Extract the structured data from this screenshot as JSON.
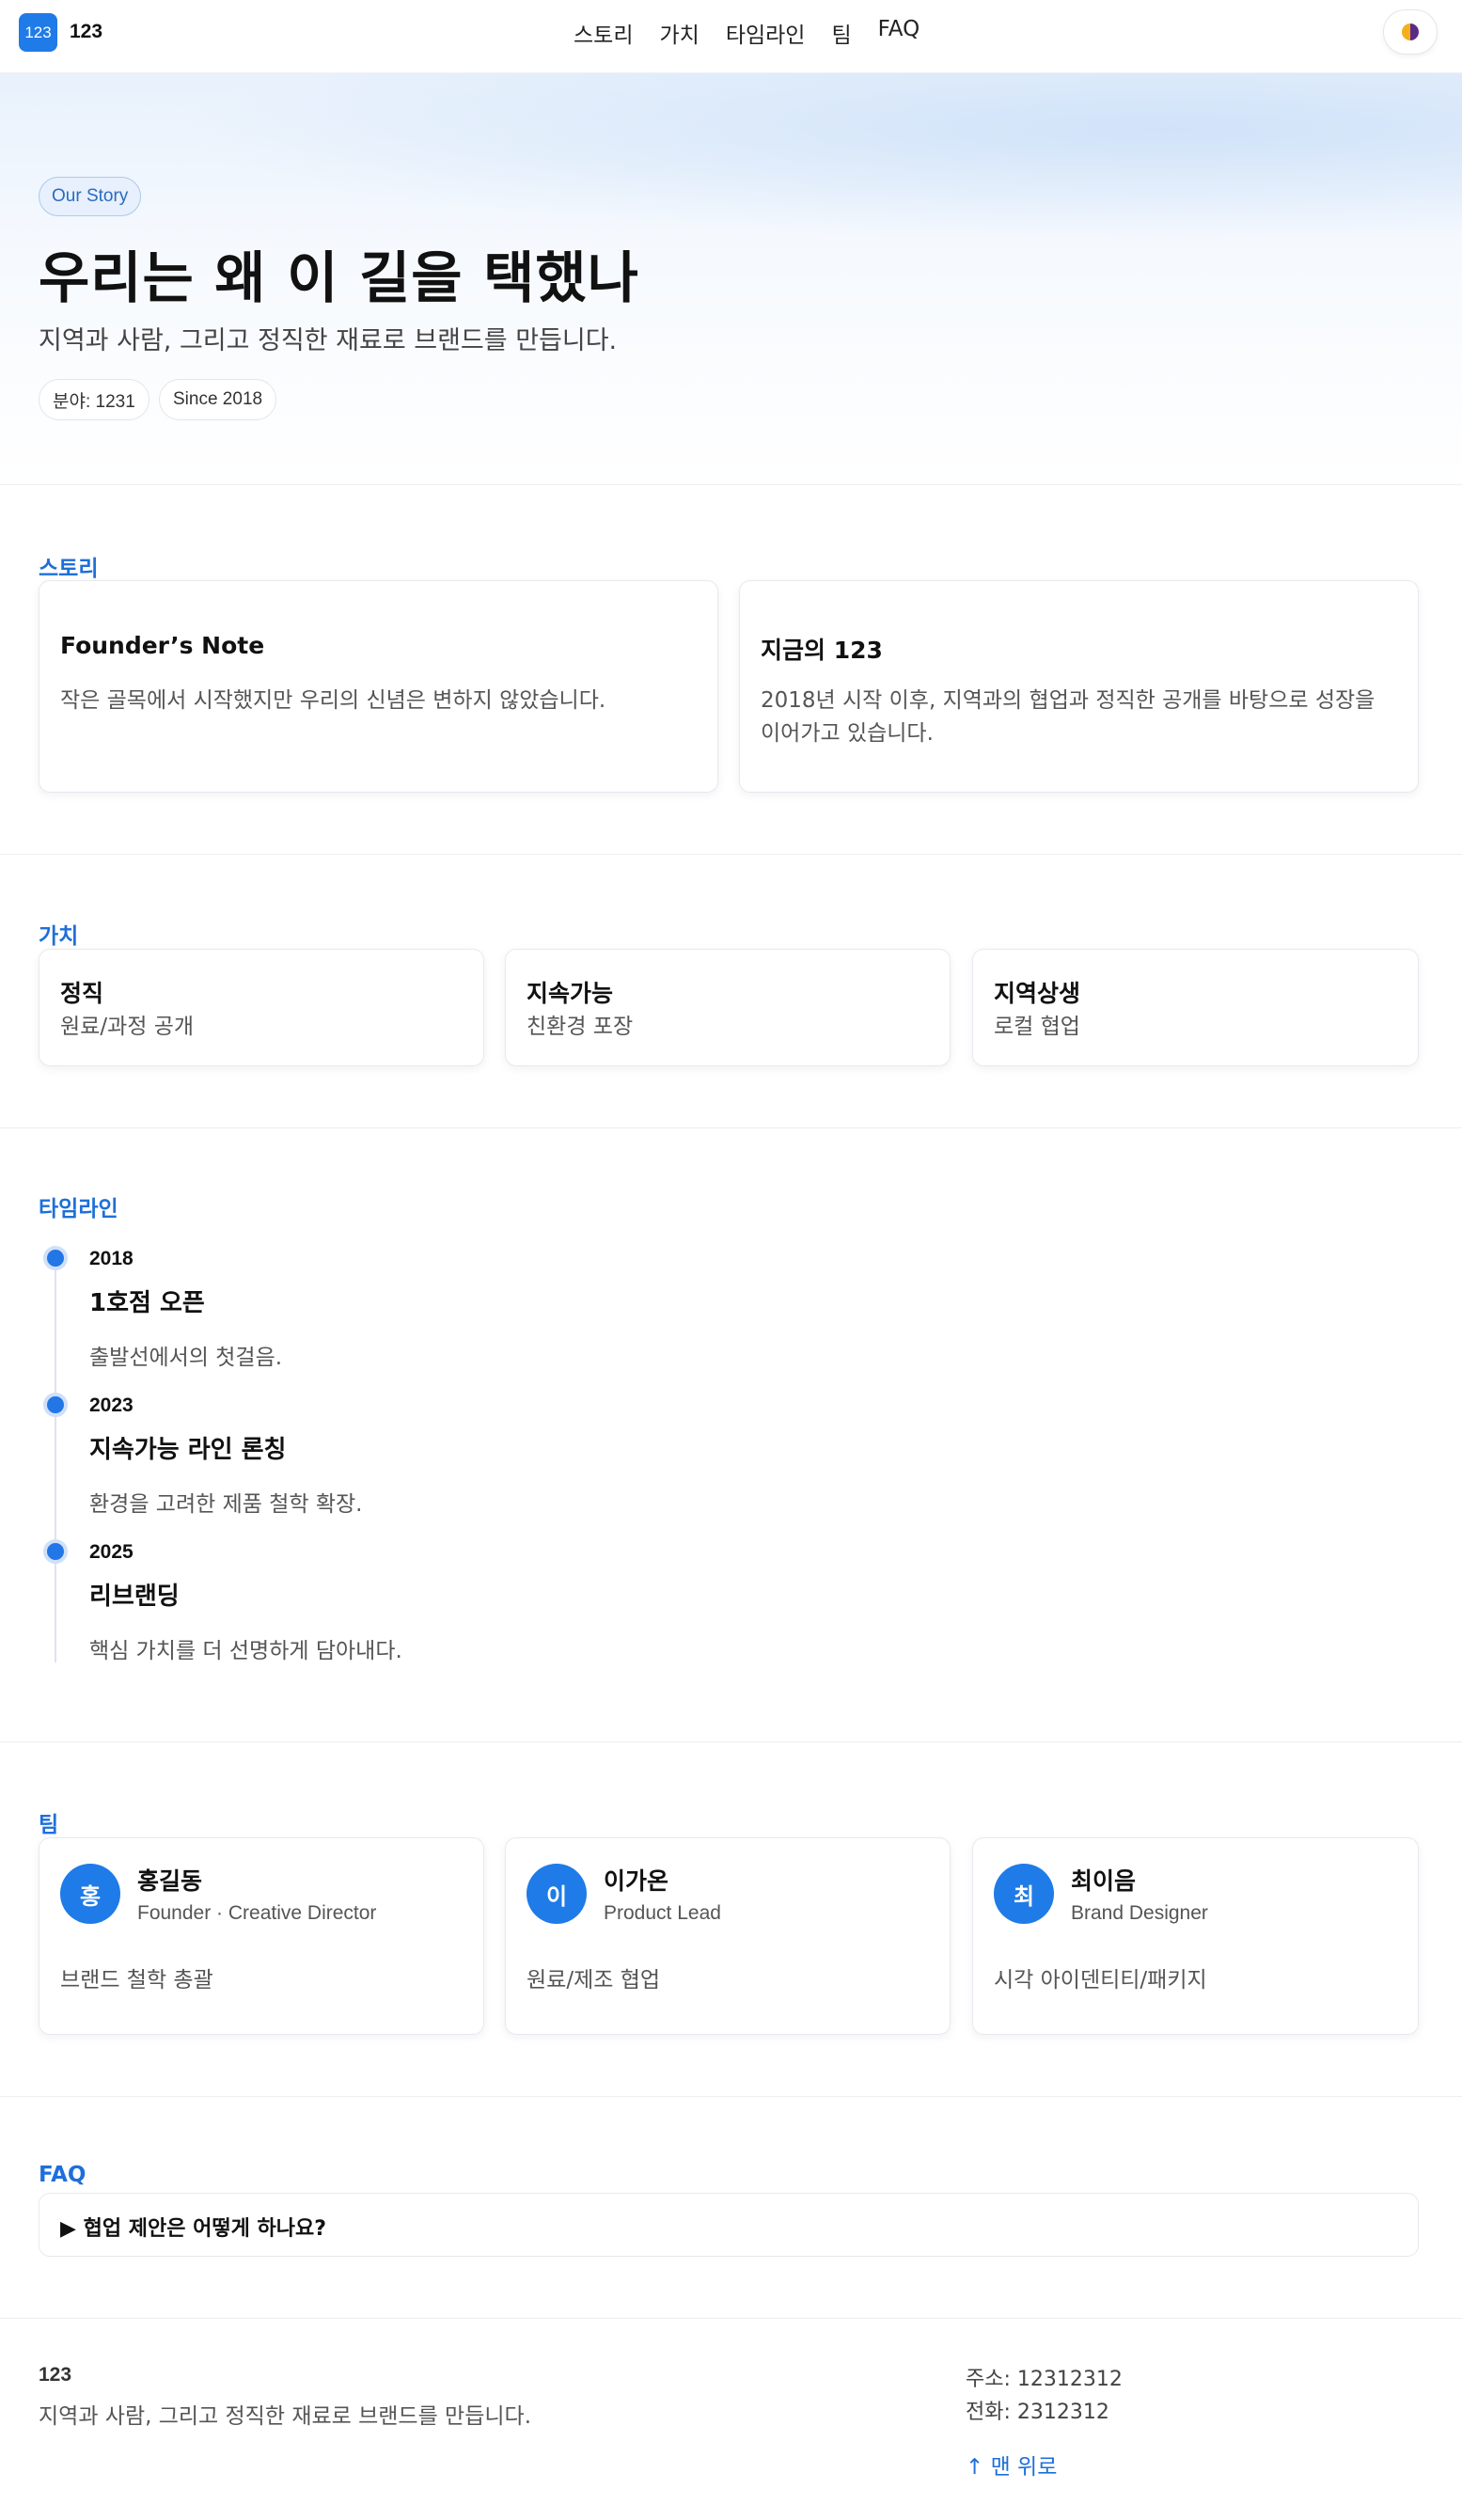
{
  "header": {
    "logo_badge": "123",
    "logo_text": "123",
    "nav": [
      "스토리",
      "가치",
      "타임라인",
      "팀",
      "FAQ"
    ],
    "theme_icon": "half-circle-icon"
  },
  "hero": {
    "pill": "Our Story",
    "title": "우리는 왜 이 길을 택했나",
    "subtitle": "지역과 사람, 그리고 정직한 재료로 브랜드를 만듭니다.",
    "tags": [
      "분야: 1231",
      "Since 2018"
    ]
  },
  "story": {
    "label": "스토리",
    "cards": [
      {
        "title": "Founder’s Note",
        "text": "작은 골목에서 시작했지만 우리의 신념은 변하지 않았습니다."
      },
      {
        "title": "지금의 123",
        "text": "2018년 시작 이후, 지역과의 협업과 정직한 공개를 바탕으로 성장을 이어가고 있습니다."
      }
    ]
  },
  "values": {
    "label": "가치",
    "cards": [
      {
        "title": "정직",
        "text": "원료/과정 공개"
      },
      {
        "title": "지속가능",
        "text": "친환경 포장"
      },
      {
        "title": "지역상생",
        "text": "로컬 협업"
      }
    ]
  },
  "timeline": {
    "label": "타임라인",
    "items": [
      {
        "year": "2018",
        "title": "1호점 오픈",
        "desc": "출발선에서의 첫걸음."
      },
      {
        "year": "2023",
        "title": "지속가능 라인 론칭",
        "desc": "환경을 고려한 제품 철학 확장."
      },
      {
        "year": "2025",
        "title": "리브랜딩",
        "desc": "핵심 가치를 더 선명하게 담아내다."
      }
    ]
  },
  "team": {
    "label": "팀",
    "members": [
      {
        "initial": "홍",
        "name": "홍길동",
        "role": "Founder · Creative Director",
        "desc": "브랜드 철학 총괄"
      },
      {
        "initial": "이",
        "name": "이가온",
        "role": "Product Lead",
        "desc": "원료/제조 협업"
      },
      {
        "initial": "최",
        "name": "최이음",
        "role": "Brand Designer",
        "desc": "시각 아이덴티티/패키지"
      }
    ]
  },
  "faq": {
    "label": "FAQ",
    "question": "▶ 협업 제안은 어떻게 하나요?"
  },
  "footer": {
    "name": "123",
    "tagline": "지역과 사람, 그리고 정직한 재료로 브랜드를 만듭니다.",
    "address": "주소: 12312312",
    "phone": "전화: 2312312",
    "back_to_top": "↑ 맨 위로"
  }
}
